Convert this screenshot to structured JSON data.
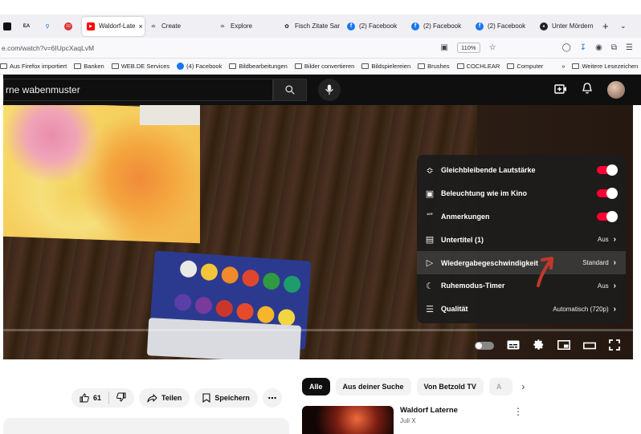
{
  "browser": {
    "tabs": [
      {
        "label": "",
        "icon": "dark-app-icon"
      },
      {
        "label": "",
        "icon": "ea-icon",
        "glyph": "EA"
      },
      {
        "label": "",
        "icon": "search-icon"
      },
      {
        "label": "",
        "icon": "badge-icon",
        "badge": "10"
      },
      {
        "label": "Waldorf-Late",
        "icon": "youtube-icon",
        "active": true
      },
      {
        "label": "Create",
        "icon": "create-icon"
      },
      {
        "label": "Explore",
        "icon": "explore-icon"
      },
      {
        "label": "Fisch Zitate Sar",
        "icon": "fish-icon"
      },
      {
        "label": "(2) Facebook",
        "icon": "facebook-icon"
      },
      {
        "label": "(2) Facebook",
        "icon": "facebook-icon"
      },
      {
        "label": "(2) Facebook",
        "icon": "facebook-icon"
      },
      {
        "label": "Unter Mördern",
        "icon": "shield-icon"
      }
    ],
    "url": "e.com/watch?v=6IUpcXaqLvM",
    "zoom": "110%",
    "bookmarks": [
      {
        "label": "Aus Firefox importiert",
        "type": "folder"
      },
      {
        "label": "Banken",
        "type": "folder"
      },
      {
        "label": "WEB.DE Services",
        "type": "folder"
      },
      {
        "label": "(4) Facebook",
        "type": "facebook"
      },
      {
        "label": "Bildbearbeitungen",
        "type": "folder"
      },
      {
        "label": "Bilder convertieren",
        "type": "folder"
      },
      {
        "label": "Bildspielereien",
        "type": "folder"
      },
      {
        "label": "Brushes",
        "type": "folder"
      },
      {
        "label": "COCHLEAR",
        "type": "folder"
      },
      {
        "label": "Computer",
        "type": "folder"
      }
    ],
    "bookmarks_more": "Weitere Lesezeichen"
  },
  "youtube": {
    "search_value": "rne wabenmuster",
    "settings_menu": [
      {
        "label": "Gleichbleibende Lautstärke",
        "icon": "volume-wave-icon",
        "toggle": true
      },
      {
        "label": "Beleuchtung wie im Kino",
        "icon": "ambient-icon",
        "toggle": true
      },
      {
        "label": "Anmerkungen",
        "icon": "annotations-icon",
        "toggle": true
      },
      {
        "label": "Untertitel (1)",
        "icon": "subtitles-icon",
        "value": "Aus"
      },
      {
        "label": "Wiedergabegeschwindigkeit",
        "icon": "speed-icon",
        "value": "Standard",
        "highlighted": true
      },
      {
        "label": "Ruhemodus-Timer",
        "icon": "sleep-timer-icon",
        "value": "Aus"
      },
      {
        "label": "Qualität",
        "icon": "quality-icon",
        "value": "Automatisch (720p)"
      }
    ],
    "actions": {
      "likes": "61",
      "share": "Teilen",
      "save": "Speichern"
    },
    "chips": [
      "Alle",
      "Aus deiner Suche",
      "Von Betzold TV",
      "A"
    ],
    "recommendation": {
      "title": "Waldorf Laterne",
      "channel": "Juli X"
    }
  },
  "colors": {
    "youtube_red": "#ff0033",
    "annotation_arrow": "#c0392b"
  }
}
